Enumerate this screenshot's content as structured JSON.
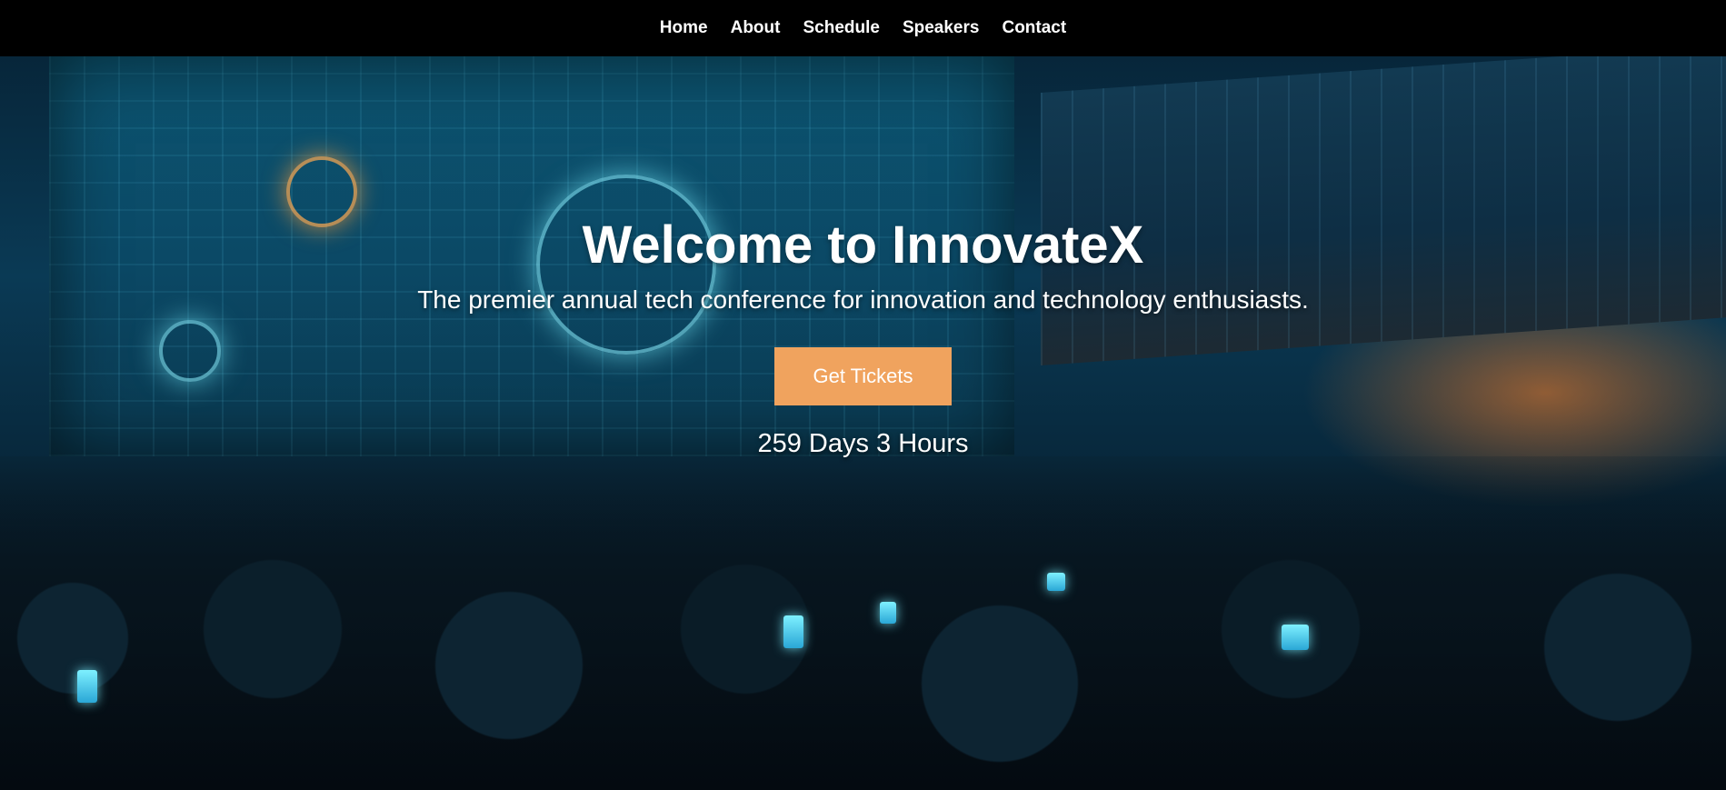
{
  "nav": {
    "items": [
      {
        "label": "Home"
      },
      {
        "label": "About"
      },
      {
        "label": "Schedule"
      },
      {
        "label": "Speakers"
      },
      {
        "label": "Contact"
      }
    ]
  },
  "hero": {
    "title": "Welcome to InnovateX",
    "subtitle": "The premier annual tech conference for innovation and technology enthusiasts.",
    "cta_label": "Get Tickets",
    "countdown": "259 Days 3 Hours"
  },
  "colors": {
    "nav_background": "#000000",
    "cta_background": "#f0a35e",
    "text": "#ffffff"
  }
}
